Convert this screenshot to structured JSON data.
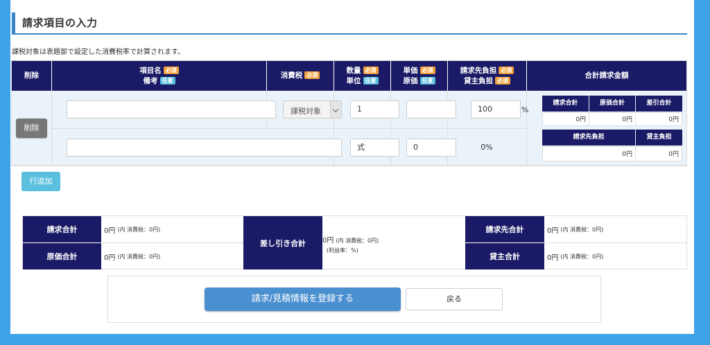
{
  "section": {
    "title": "請求項目の入力"
  },
  "note": "課税対象は表題部で設定した消費税率で計算されます。",
  "badges": {
    "required": "必須",
    "optional": "任意"
  },
  "headers": {
    "delete": "削除",
    "item_name": "項目名",
    "remarks": "備考",
    "tax": "消費税",
    "quantity": "数量",
    "unit": "単位",
    "unit_price": "単価",
    "cost": "原価",
    "billing_share": "請求先負担",
    "lender_share": "貸主負担",
    "total": "合計請求金額"
  },
  "row": {
    "item_name_value": "",
    "tax_select": "課税対象",
    "quantity_value": "1",
    "unit_price_value": "",
    "billing_share_value": "100",
    "percent": "%",
    "remarks_value": "",
    "unit_value": "式",
    "cost_value": "0",
    "lender_share_pct": "0%",
    "delete_button": "削除"
  },
  "mini_table": {
    "request_total_label": "請求合計",
    "cost_total_label": "原価合計",
    "diff_total_label": "差引合計",
    "request_total_value": "0円",
    "cost_total_value": "0円",
    "diff_total_value": "0円",
    "billing_share_label": "請求先負担",
    "lender_share_label": "貸主負担",
    "billing_share_value": "0円",
    "lender_share_value": "0円"
  },
  "add_row_button": "行追加",
  "summary": {
    "request_total_label": "請求合計",
    "request_total_value": "0円",
    "request_total_tax": "(内 消費税：0円)",
    "cost_total_label": "原価合計",
    "cost_total_value": "0円",
    "cost_total_tax": "(内 消費税：0円)",
    "diff_label": "差し引き合計",
    "diff_value": "0円",
    "diff_tax": "(内 消費税：0円)",
    "diff_margin": "(利益率：%)",
    "billing_total_label": "請求先合計",
    "billing_total_value": "0円",
    "billing_total_tax": "(内 消費税：0円)",
    "lender_total_label": "貸主合計",
    "lender_total_value": "0円",
    "lender_total_tax": "(内 消費税：0円)"
  },
  "footer": {
    "submit_button": "請求/見積情報を登録する",
    "back_button": "戻る"
  },
  "colors": {
    "header_navy": "#1a1a66",
    "accent_blue": "#3a87c8",
    "required_orange": "#f2a13a",
    "optional_cyan": "#5bc0de",
    "background_blue": "#3ea2e6"
  }
}
